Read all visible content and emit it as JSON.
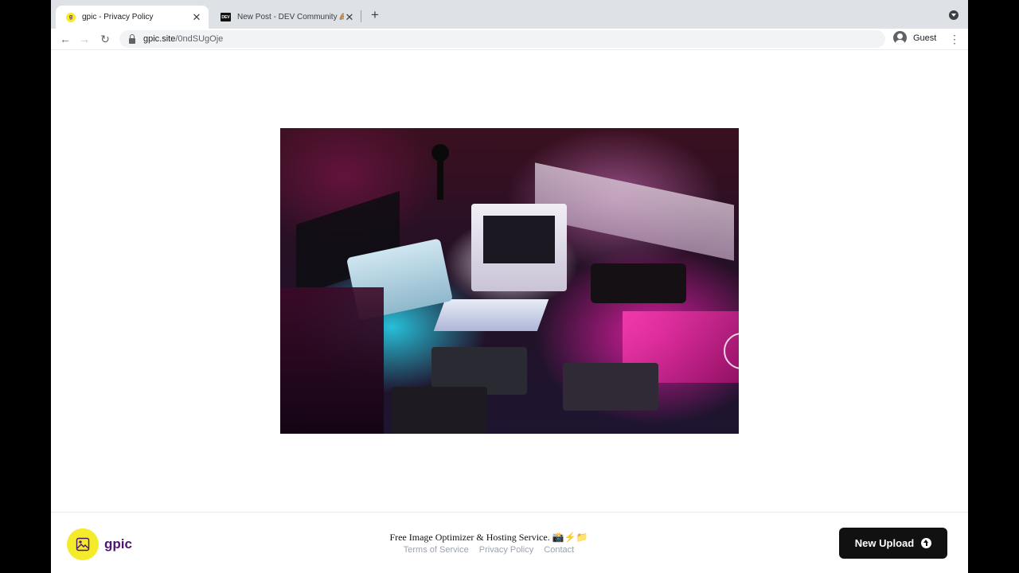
{
  "browser": {
    "tabs": [
      {
        "title": "gpic - Privacy Policy",
        "favicon": "gpic-logo-icon",
        "active": true
      },
      {
        "title": "New Post - DEV Community 🙈",
        "favicon": "dev-logo-icon",
        "active": false
      }
    ],
    "url_host": "gpic.site",
    "url_path": "/0ndSUgOje",
    "profile_label": "Guest"
  },
  "page": {
    "image_description_alt": "Retro computers, keyboards, cassettes and a Game Boy in neon pink and cyan light"
  },
  "footer": {
    "brand": "gpic",
    "tagline": "Free Image Optimizer & Hosting Service. 📸⚡📁",
    "links": [
      "Terms of Service",
      "Privacy Policy",
      "Contact"
    ],
    "upload_label": "New Upload"
  },
  "colors": {
    "brand_yellow": "#f4ec2a",
    "brand_purple": "#4b1570",
    "button_dark": "#111111"
  }
}
